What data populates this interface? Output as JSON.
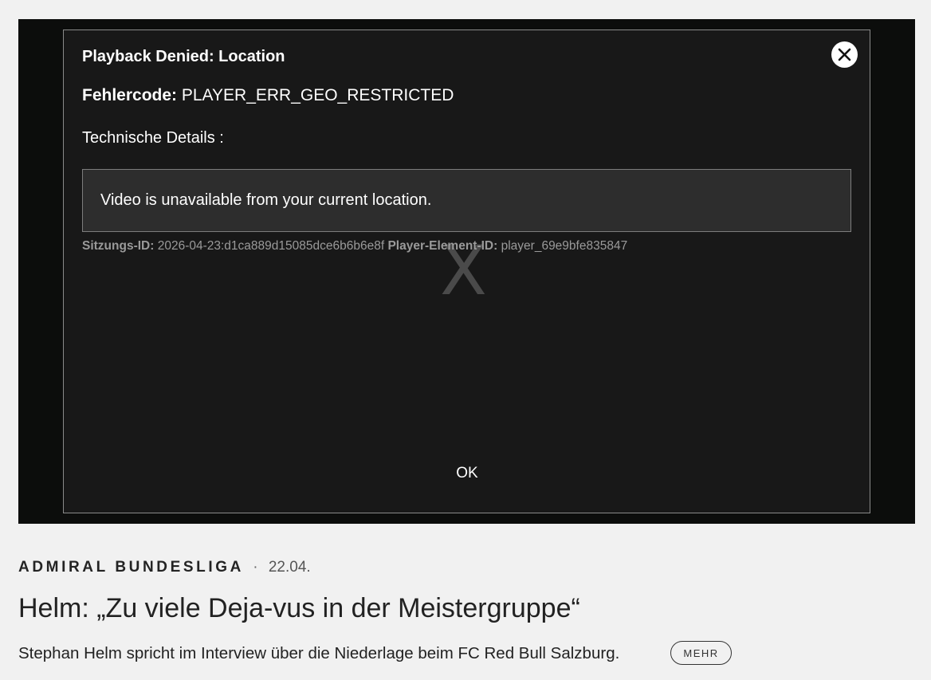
{
  "player": {
    "dialog": {
      "title": "Playback Denied: Location",
      "error_code_label": "Fehlercode:",
      "error_code_value": "PLAYER_ERR_GEO_RESTRICTED",
      "tech_details_label": "Technische Details :",
      "message": "Video is unavailable from your current location.",
      "session_id_label": "Sitzungs-ID:",
      "session_id_value": "2026-04-23:d1ca889d15085dce6b6b6e8f",
      "player_element_id_label": "Player-Element-ID:",
      "player_element_id_value": "player_69e9bfe835847",
      "background_glyph": "X",
      "ok_label": "OK",
      "close_icon": "close-icon"
    }
  },
  "article": {
    "league": "ADMIRAL BUNDESLIGA",
    "separator": "·",
    "date": "22.04.",
    "headline": "Helm: „Zu viele Deja-vus in der Meistergruppe“",
    "teaser": "Stephan Helm spricht im Interview über die Niederlage beim FC Red Bull Salzburg.",
    "more_label": "MEHR"
  },
  "colors": {
    "page_background": "#f1f1f1",
    "player_background": "#0c0d0c",
    "dialog_background": "#181818",
    "message_box_background": "#2d2d2d"
  }
}
